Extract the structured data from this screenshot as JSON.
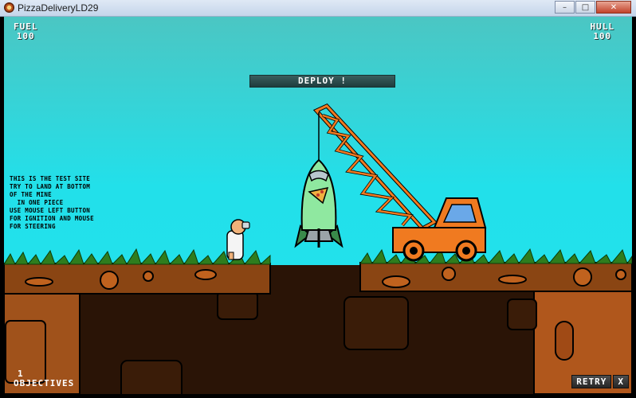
{
  "window": {
    "title": "PizzaDeliveryLD29",
    "minimize": "–",
    "maximize": "□",
    "close": "✕"
  },
  "hud": {
    "fuel_label": "FUEL",
    "fuel_value": "100",
    "hull_label": "HULL",
    "hull_value": "100"
  },
  "deploy_label": "DEPLOY !",
  "instructions": [
    "THIS IS THE TEST SITE",
    "TRY TO LAND AT BOTTOM",
    "OF THE MINE",
    "  IN ONE PIECE",
    "USE MOUSE LEFT BUTTON",
    "FOR IGNITION AND MOUSE",
    "FOR STEERING"
  ],
  "objectives": {
    "count": "1",
    "label": "OBJECTIVES"
  },
  "buttons": {
    "retry": "RETRY",
    "close": "X"
  },
  "icons": {
    "app": "pizza-icon",
    "rocket": "rocket-sprite",
    "crane": "crane-truck-sprite",
    "scientist": "scientist-sprite"
  },
  "colors": {
    "sky": "#22e0ea",
    "dirt": "#8a4513",
    "underground": "#2a1406",
    "grass": "#2e7d1e",
    "crane": "#f07a20",
    "rocket": "#8fe8a0"
  }
}
